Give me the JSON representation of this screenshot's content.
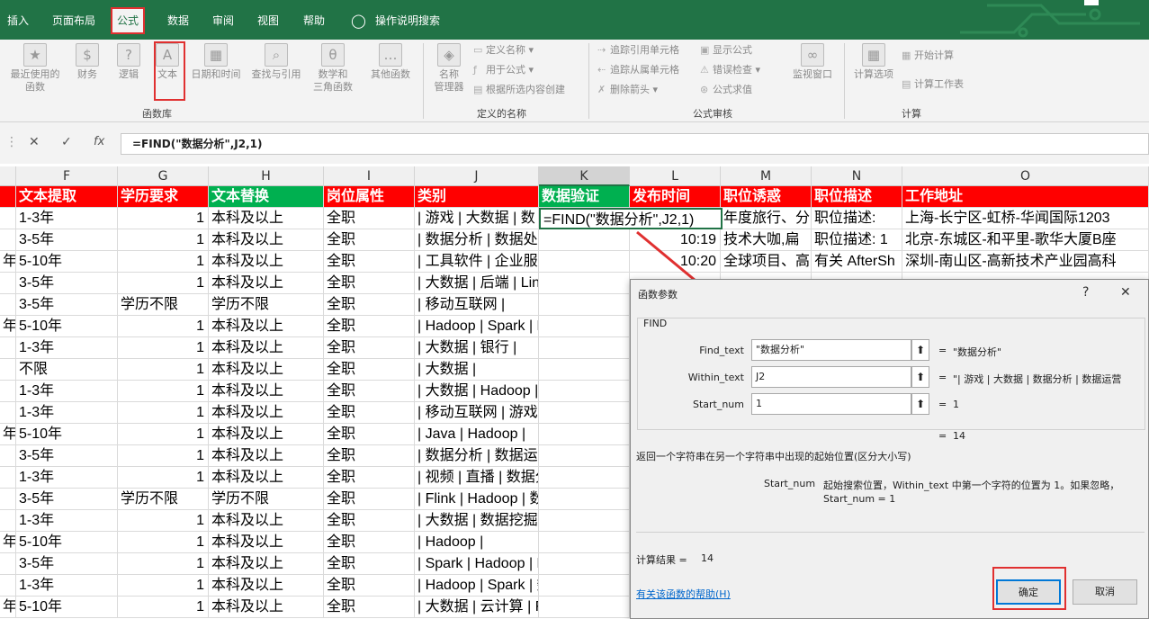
{
  "menu": {
    "tabs": [
      "插入",
      "页面布局",
      "公式",
      "数据",
      "审阅",
      "视图",
      "帮助"
    ],
    "active_tab": "公式",
    "tellme_icon": "lightbulb-icon",
    "tellme_label": "操作说明搜索"
  },
  "ribbon": {
    "library": {
      "recent": "最近使用的\n函数",
      "finance": "财务",
      "logic": "逻辑",
      "text": "文本",
      "datetime": "日期和时间",
      "lookup": "查找与引用",
      "math": "数学和\n三角函数",
      "more": "其他函数",
      "group": "函数库"
    },
    "names": {
      "manager": "名称\n管理器",
      "define": "定义名称",
      "use_in_formula": "用于公式",
      "create": "根据所选内容创建",
      "group": "定义的名称"
    },
    "audit": {
      "trace_precedents": "追踪引用单元格",
      "trace_dependents": "追踪从属单元格",
      "remove_arrows": "删除箭头",
      "show_formulas": "显示公式",
      "error_check": "错误检查",
      "evaluate": "公式求值",
      "watch": "监视窗口",
      "group": "公式审核"
    },
    "calc": {
      "options": "计算选项",
      "calc_now": "开始计算",
      "calc_sheet": "计算工作表",
      "group": "计算"
    }
  },
  "formula_bar": {
    "formula": "=FIND(\"数据分析\",J2,1)"
  },
  "columns": [
    "F",
    "G",
    "H",
    "I",
    "J",
    "K",
    "L",
    "M",
    "N",
    "O"
  ],
  "header_row": [
    "文本提取",
    "学历要求",
    "文本替换",
    "岗位属性",
    "类别",
    "数据验证",
    "发布时间",
    "职位诱惑",
    "职位描述",
    "工作地址"
  ],
  "rows": [
    {
      "e": "",
      "f": "1-3年",
      "g": "1",
      "h": "本科及以上",
      "i": "全职",
      "j": "| 游戏 | 大数据 | 数",
      "k": "=FIND(\"数据分析\",J2,1)",
      "l": "",
      "m": "年度旅行、分",
      "n": "职位描述:",
      "o": "上海-长宁区-虹桥-华闻国际1203"
    },
    {
      "e": "",
      "f": "3-5年",
      "g": "1",
      "h": "本科及以上",
      "i": "全职",
      "j": "| 数据分析 | 数据处理 | Storm |",
      "k": "",
      "l": "10:19",
      "m": "技术大咖,扁",
      "n": "职位描述: 1",
      "o": "北京-东城区-和平里-歌华大厦B座"
    },
    {
      "e": "年",
      "f": "5-10年",
      "g": "1",
      "h": "本科及以上",
      "i": "全职",
      "j": "| 工具软件 | 企业服务 |",
      "k": "",
      "l": "10:20",
      "m": "全球项目、高",
      "n": "有关 AfterSh",
      "o": "深圳-南山区-高新技术产业园高科"
    },
    {
      "e": "",
      "f": "3-5年",
      "g": "1",
      "h": "本科及以上",
      "i": "全职",
      "j": "| 大数据 | 后端 | Linux/Unix | Ja",
      "k": "",
      "l": "",
      "m": "",
      "n": "",
      "o": ""
    },
    {
      "e": "",
      "f": "3-5年",
      "g": "学历不限",
      "h": "学历不限",
      "i": "全职",
      "j": "| 移动互联网 |",
      "k": "",
      "l": "",
      "m": "",
      "n": "",
      "o": ""
    },
    {
      "e": "年",
      "f": "5-10年",
      "g": "1",
      "h": "本科及以上",
      "i": "全职",
      "j": "| Hadoop | Spark | Flink | Hive |",
      "k": "",
      "l": "",
      "m": "",
      "n": "",
      "o": ""
    },
    {
      "e": "",
      "f": "1-3年",
      "g": "1",
      "h": "本科及以上",
      "i": "全职",
      "j": "| 大数据 | 银行 |",
      "k": "",
      "l": "",
      "m": "",
      "n": "",
      "o": ""
    },
    {
      "e": "",
      "f": "不限",
      "g": "1",
      "h": "本科及以上",
      "i": "全职",
      "j": "| 大数据 |",
      "k": "",
      "l": "",
      "m": "",
      "n": "",
      "o": ""
    },
    {
      "e": "",
      "f": "1-3年",
      "g": "1",
      "h": "本科及以上",
      "i": "全职",
      "j": "| 大数据 | Hadoop | Spark | 数",
      "k": "",
      "l": "",
      "m": "",
      "n": "",
      "o": ""
    },
    {
      "e": "",
      "f": "1-3年",
      "g": "1",
      "h": "本科及以上",
      "i": "全职",
      "j": "| 移动互联网 | 游戏 | 数据挖掘",
      "k": "",
      "l": "",
      "m": "",
      "n": "",
      "o": ""
    },
    {
      "e": "年",
      "f": "5-10年",
      "g": "1",
      "h": "本科及以上",
      "i": "全职",
      "j": "| Java | Hadoop |",
      "k": "",
      "l": "",
      "m": "",
      "n": "",
      "o": ""
    },
    {
      "e": "",
      "f": "3-5年",
      "g": "1",
      "h": "本科及以上",
      "i": "全职",
      "j": "| 数据分析 | 数据运营 | SQL | 数",
      "k": "",
      "l": "",
      "m": "",
      "n": "",
      "o": ""
    },
    {
      "e": "",
      "f": "1-3年",
      "g": "1",
      "h": "本科及以上",
      "i": "全职",
      "j": "| 视频 | 直播 | 数据分析 | 数据",
      "k": "",
      "l": "",
      "m": "",
      "n": "",
      "o": ""
    },
    {
      "e": "",
      "f": "3-5年",
      "g": "学历不限",
      "h": "学历不限",
      "i": "全职",
      "j": "| Flink | Hadoop | 数据架构 | Ja",
      "k": "",
      "l": "",
      "m": "",
      "n": "",
      "o": ""
    },
    {
      "e": "",
      "f": "1-3年",
      "g": "1",
      "h": "本科及以上",
      "i": "全职",
      "j": "| 大数据 | 数据挖掘 | 数据分析",
      "k": "",
      "l": "",
      "m": "",
      "n": "",
      "o": ""
    },
    {
      "e": "年",
      "f": "5-10年",
      "g": "1",
      "h": "本科及以上",
      "i": "全职",
      "j": "| Hadoop |",
      "k": "",
      "l": "",
      "m": "",
      "n": "",
      "o": ""
    },
    {
      "e": "",
      "f": "3-5年",
      "g": "1",
      "h": "本科及以上",
      "i": "全职",
      "j": "| Spark | Hadoop | Hive |",
      "k": "",
      "l": "",
      "m": "",
      "n": "",
      "o": ""
    },
    {
      "e": "",
      "f": "1-3年",
      "g": "1",
      "h": "本科及以上",
      "i": "全职",
      "j": "| Hadoop | Spark | 数据分析 | 数",
      "k": "",
      "l": "",
      "m": "",
      "n": "",
      "o": ""
    },
    {
      "e": "年",
      "f": "5-10年",
      "g": "1",
      "h": "本科及以上",
      "i": "全职",
      "j": "| 大数据 | 云计算 | Flink | 数据",
      "k": "",
      "l": "",
      "m": "",
      "n": "",
      "o": ""
    }
  ],
  "dialog": {
    "title": "函数参数",
    "function_name": "FIND",
    "args": [
      {
        "label": "Find_text",
        "value": "\"数据分析\"",
        "result": "\"数据分析\""
      },
      {
        "label": "Within_text",
        "value": "J2",
        "result": "\"| 游戏 | 大数据 | 数据分析 | 数据运营"
      },
      {
        "label": "Start_num",
        "value": "1",
        "result": "1"
      }
    ],
    "eq": "=",
    "total": "14",
    "description": "返回一个字符串在另一个字符串中出现的起始位置(区分大小写)",
    "param_name": "Start_num",
    "param_desc": "起始搜索位置，Within_text 中第一个字符的位置为 1。如果忽略，",
    "param_desc2": "Start_num = 1",
    "result_label": "计算结果 =",
    "result_value": "14",
    "help_link": "有关该函数的帮助(H)",
    "ok": "确定",
    "cancel": "取消",
    "help_btn": "?",
    "close_btn": "✕"
  },
  "colors": {
    "excel_green": "#217346",
    "header_red": "#ff0000",
    "header_green": "#00b050",
    "highlight": "#e03030"
  }
}
